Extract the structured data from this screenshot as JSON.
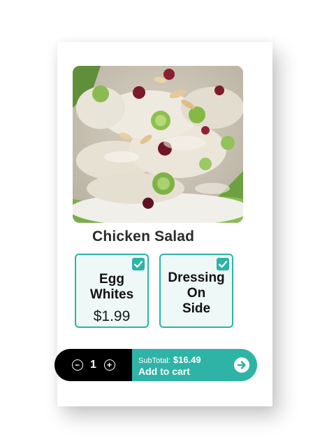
{
  "product": {
    "name": "Chicken Salad",
    "image_icon": "chicken-salad-photo"
  },
  "options": [
    {
      "name_lines": [
        "Egg",
        "Whites"
      ],
      "price": "$1.99",
      "checked": true
    },
    {
      "name_lines": [
        "Dressing",
        "On",
        "Side"
      ],
      "price": "",
      "checked": true
    }
  ],
  "cart": {
    "quantity": "1",
    "decrement_symbol": "−",
    "increment_symbol": "+",
    "subtotal_label": "SubTotal:",
    "subtotal_value": "$16.49",
    "add_label": "Add to cart",
    "arrow_icon": "arrow-right-circle-icon"
  },
  "colors": {
    "accent": "#2fb3a6",
    "option_bg": "#eef8f7",
    "qty_bg": "#000000"
  }
}
